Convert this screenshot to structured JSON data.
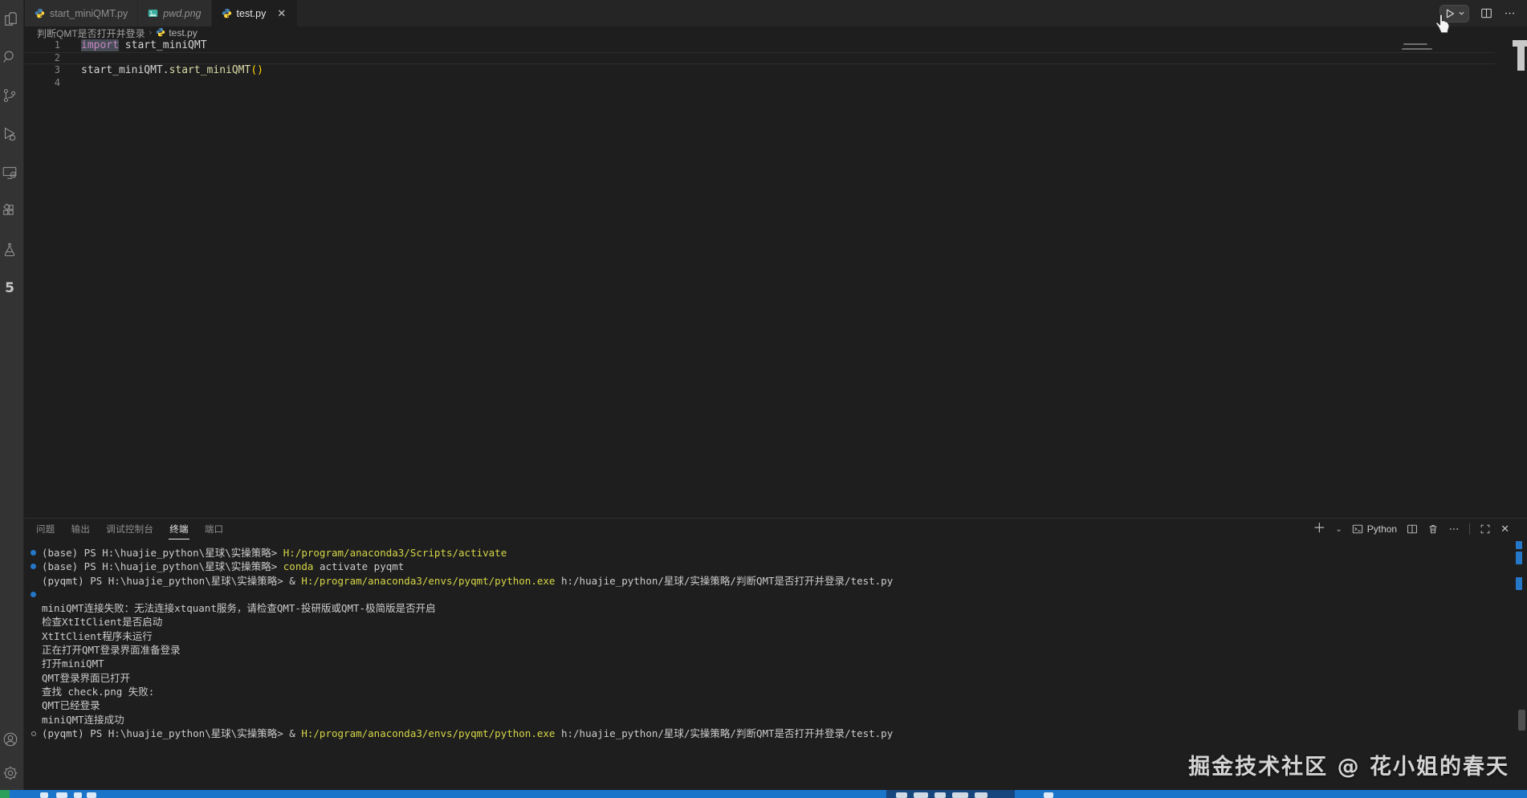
{
  "activity_bar": {
    "items": [
      {
        "name": "explorer"
      },
      {
        "name": "search"
      },
      {
        "name": "source-control"
      },
      {
        "name": "run-and-debug"
      },
      {
        "name": "remote-explorer"
      },
      {
        "name": "extensions"
      },
      {
        "name": "testing"
      },
      {
        "name": "custom-extension",
        "glyph": "5"
      }
    ],
    "bottom": [
      {
        "name": "account"
      },
      {
        "name": "settings"
      }
    ]
  },
  "tabs": [
    {
      "label": "start_miniQMT.py",
      "icon": "python",
      "active": false,
      "preview": false,
      "closable": false
    },
    {
      "label": "pwd.png",
      "icon": "image",
      "active": false,
      "preview": true,
      "closable": false
    },
    {
      "label": "test.py",
      "icon": "python",
      "active": true,
      "preview": false,
      "closable": true,
      "close_glyph": "✕"
    }
  ],
  "breadcrumb": {
    "folder": "判断QMT是否打开并登录",
    "separator": "›",
    "file": "test.py"
  },
  "editor": {
    "lines": [
      {
        "num": "1",
        "current": false,
        "tokens": [
          {
            "t": "import",
            "c": "kw",
            "hl": true
          },
          {
            "t": " start_miniQMT",
            "c": "pl"
          }
        ]
      },
      {
        "num": "2",
        "current": true,
        "tokens": []
      },
      {
        "num": "3",
        "current": false,
        "tokens": [
          {
            "t": "start_miniQMT.",
            "c": "pl"
          },
          {
            "t": "start_miniQMT",
            "c": "fn"
          },
          {
            "t": "()",
            "c": "br"
          }
        ]
      },
      {
        "num": "4",
        "current": false,
        "tokens": []
      }
    ]
  },
  "panel": {
    "tabs": [
      {
        "label": "问题",
        "active": false
      },
      {
        "label": "输出",
        "active": false
      },
      {
        "label": "调试控制台",
        "active": false
      },
      {
        "label": "终端",
        "active": true
      },
      {
        "label": "端口",
        "active": false
      }
    ],
    "toolbar": {
      "profile_label": "Python",
      "close_glyph": "✕",
      "plus_glyph": "＋",
      "chevron_glyph": "⌄"
    },
    "terminal_lines": [
      {
        "dot": "filled",
        "segs": [
          {
            "t": "(base) PS H:\\huajie_python\\星球\\实操策略> ",
            "c": "p"
          },
          {
            "t": "H:/program/anaconda3/Scripts/activate",
            "c": "y"
          }
        ]
      },
      {
        "dot": "filled",
        "segs": [
          {
            "t": "(base) PS H:\\huajie_python\\星球\\实操策略> ",
            "c": "p"
          },
          {
            "t": "conda ",
            "c": "y"
          },
          {
            "t": "activate pyqmt",
            "c": "p"
          }
        ]
      },
      {
        "dot": "none",
        "segs": [
          {
            "t": "(pyqmt) PS H:\\huajie_python\\星球\\实操策略> & ",
            "c": "p"
          },
          {
            "t": "H:/program/anaconda3/envs/pyqmt/python.exe",
            "c": "y"
          },
          {
            "t": " h:/huajie_python/星球/实操策略/判断QMT是否打开并登录/test.py",
            "c": "p"
          }
        ]
      },
      {
        "dot": "filled",
        "segs": []
      },
      {
        "dot": "none",
        "segs": [
          {
            "t": "miniQMT连接失败：无法连接xtquant服务，请检查QMT-投研版或QMT-极简版是否开启",
            "c": "p"
          }
        ]
      },
      {
        "dot": "none",
        "segs": [
          {
            "t": "检查XtItClient是否启动",
            "c": "p"
          }
        ]
      },
      {
        "dot": "none",
        "segs": [
          {
            "t": "XtItClient程序未运行",
            "c": "p"
          }
        ]
      },
      {
        "dot": "none",
        "segs": [
          {
            "t": "正在打开QMT登录界面准备登录",
            "c": "p"
          }
        ]
      },
      {
        "dot": "none",
        "segs": [
          {
            "t": "打开miniQMT",
            "c": "p"
          }
        ]
      },
      {
        "dot": "none",
        "segs": [
          {
            "t": "QMT登录界面已打开",
            "c": "p"
          }
        ]
      },
      {
        "dot": "none",
        "segs": [
          {
            "t": "查找 check.png 失败:",
            "c": "p"
          }
        ]
      },
      {
        "dot": "none",
        "segs": [
          {
            "t": "QMT已经登录",
            "c": "p"
          }
        ]
      },
      {
        "dot": "none",
        "segs": [
          {
            "t": "miniQMT连接成功",
            "c": "p"
          }
        ]
      },
      {
        "dot": "hollow",
        "segs": [
          {
            "t": "(pyqmt) PS H:\\huajie_python\\星球\\实操策略> & ",
            "c": "p"
          },
          {
            "t": "H:/program/anaconda3/envs/pyqmt/python.exe",
            "c": "y"
          },
          {
            "t": " h:/huajie_python/星球/实操策略/判断QMT是否打开并登录/test.py",
            "c": "p"
          }
        ]
      }
    ]
  },
  "watermark": "掘金技术社区 @ 花小姐的春天",
  "colors": {
    "ansi_yellow": "#d6d648",
    "decoration_blue": "#2577c8",
    "status_bar_blue": "#1a74c9",
    "status_remote_green": "#2aa05c",
    "python_blue": "#4584b6",
    "python_yellow": "#ffd43b",
    "image_icon_teal": "#3dae9f"
  }
}
